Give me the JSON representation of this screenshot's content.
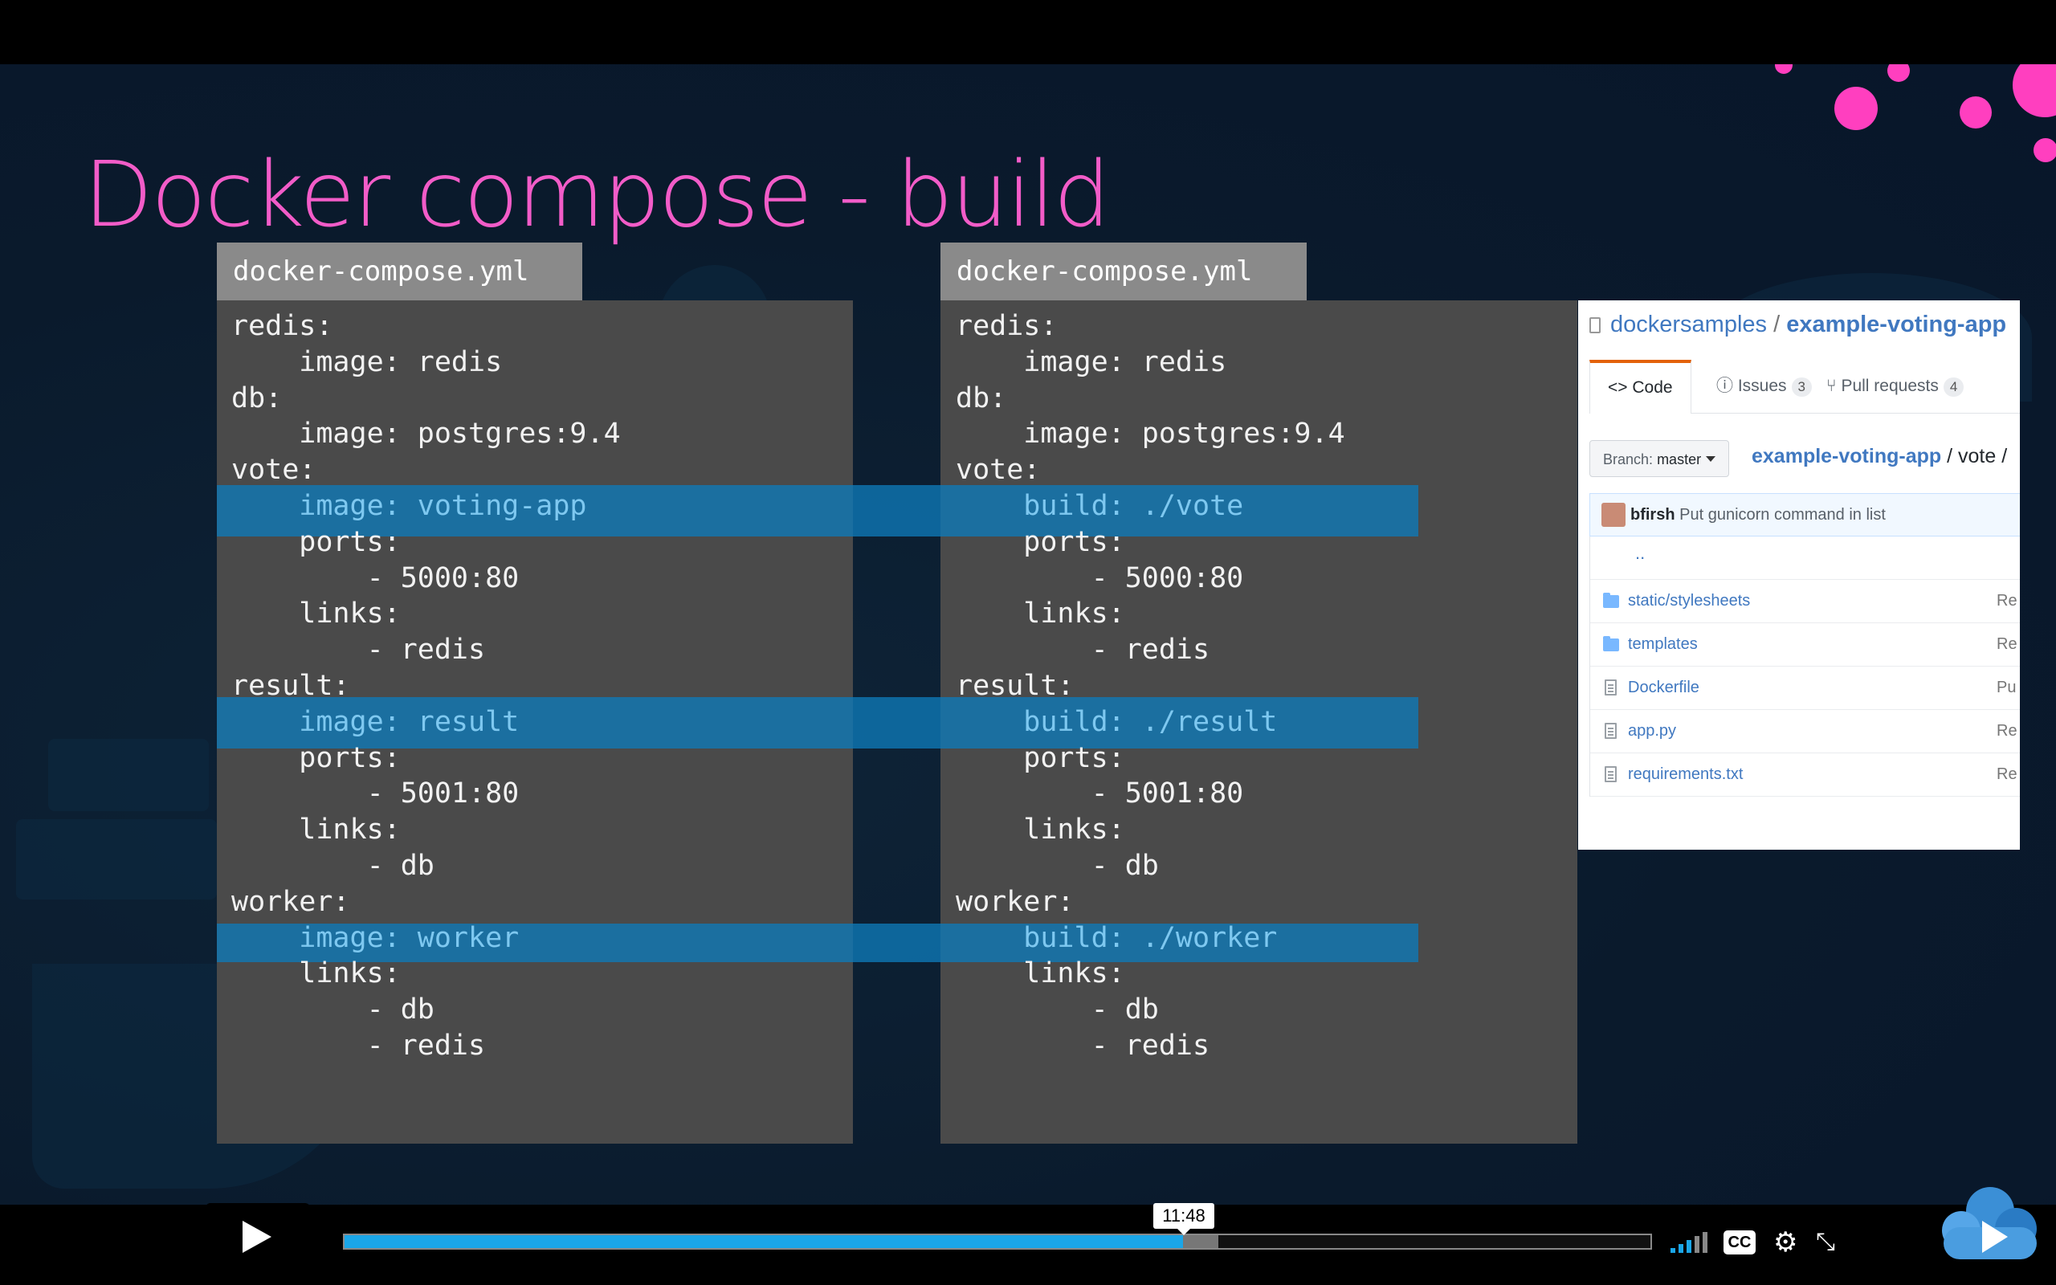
{
  "slide": {
    "title": "Docker compose - build",
    "left_panel": {
      "filename": "docker-compose.yml",
      "lines": [
        "redis:",
        "    image: redis",
        "db:",
        "    image: postgres:9.4",
        "vote:",
        "    image: voting-app",
        "    ports:",
        "        - 5000:80",
        "    links:",
        "        - redis",
        "result:",
        "    image: result",
        "    ports:",
        "        - 5001:80",
        "    links:",
        "        - db",
        "worker:",
        "    image: worker",
        "    links:",
        "        - db",
        "        - redis"
      ]
    },
    "right_panel": {
      "filename": "docker-compose.yml",
      "lines": [
        "redis:",
        "    image: redis",
        "db:",
        "    image: postgres:9.4",
        "vote:",
        "    build: ./vote",
        "    ports:",
        "        - 5000:80",
        "    links:",
        "        - redis",
        "result:",
        "    build: ./result",
        "    ports:",
        "        - 5001:80",
        "    links:",
        "        - db",
        "worker:",
        "    build: ./worker",
        "    links:",
        "        - db",
        "        - redis"
      ]
    },
    "highlight_line_indexes": [
      5,
      11,
      17
    ],
    "accent_color": "#f25cc8",
    "highlight_color": "#0e7ab9"
  },
  "github": {
    "owner": "dockersamples",
    "separator": "/",
    "repo": "example-voting-app",
    "tabs": {
      "code": "Code",
      "issues": "Issues",
      "issues_count": "3",
      "pulls": "Pull requests",
      "pulls_count": "4"
    },
    "branch_label": "Branch:",
    "branch_value": "master",
    "breadcrumb_repo": "example-voting-app",
    "breadcrumb_sep": "/",
    "breadcrumb_dir": "vote",
    "breadcrumb_trail": "/",
    "commit_user": "bfirsh",
    "commit_message": "Put gunicorn command in list",
    "up_dir": "..",
    "files": [
      {
        "name": "static/stylesheets",
        "type": "folder",
        "msg": "Re"
      },
      {
        "name": "templates",
        "type": "folder",
        "msg": "Re"
      },
      {
        "name": "Dockerfile",
        "type": "file",
        "msg": "Pu"
      },
      {
        "name": "app.py",
        "type": "file",
        "msg": "Re"
      },
      {
        "name": "requirements.txt",
        "type": "file",
        "msg": "Re"
      }
    ]
  },
  "player": {
    "time_tooltip": "11:48",
    "progress": 0.642,
    "buffered": 0.669,
    "cc_label": "CC",
    "icons": [
      "play-icon",
      "volume-icon",
      "cc-icon",
      "gear-icon",
      "fullscreen-icon",
      "cloud-play-logo"
    ]
  }
}
